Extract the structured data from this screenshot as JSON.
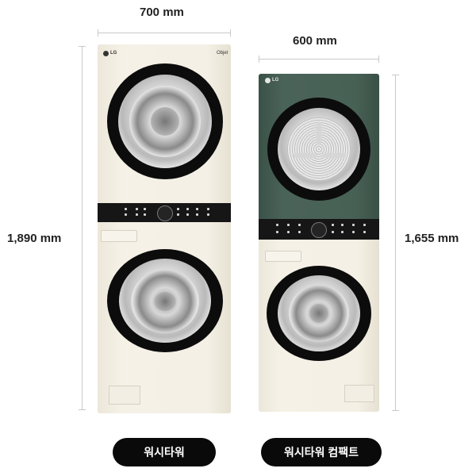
{
  "tower_left": {
    "width_label": "700 mm",
    "height_label": "1,890 mm",
    "brand": "LG",
    "badge": "Objet",
    "name_label": "워시타워"
  },
  "tower_right": {
    "width_label": "600 mm",
    "height_label": "1,655 mm",
    "brand": "LG",
    "name_label": "워시타워 컴팩트"
  },
  "colors": {
    "beige": "#f4f0e5",
    "green": "#486155",
    "control_bar": "#161616",
    "pill": "#0a0a0a"
  }
}
